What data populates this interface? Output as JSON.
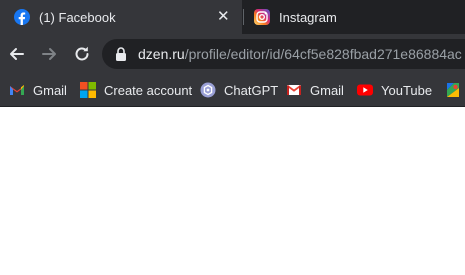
{
  "tabs": [
    {
      "title": "(1) Facebook",
      "favicon": "facebook-icon",
      "active": true,
      "close_glyph": "✕"
    },
    {
      "title": "Instagram",
      "favicon": "instagram-icon",
      "active": false
    }
  ],
  "toolbar": {
    "back_icon": "arrow-left-icon",
    "forward_icon": "arrow-right-icon",
    "reload_icon": "reload-icon",
    "lock_icon": "lock-icon",
    "url_host": "dzen.ru",
    "url_path": "/profile/editor/id/64cf5e828fbad271e86884ac"
  },
  "bookmarks": [
    {
      "label": "Gmail",
      "icon": "gmail-icon"
    },
    {
      "label": "Create account",
      "icon": "microsoft-icon"
    },
    {
      "label": "ChatGPT",
      "icon": "chatgpt-icon"
    },
    {
      "label": "Gmail",
      "icon": "gmail-icon"
    },
    {
      "label": "YouTube",
      "icon": "youtube-icon"
    },
    {
      "label": "",
      "icon": "google-maps-icon"
    }
  ],
  "colors": {
    "tabstrip_bg": "#202124",
    "toolbar_bg": "#35363a",
    "omnibox_bg": "#202124",
    "text": "#e8eaed",
    "muted_text": "#9aa0a6"
  }
}
